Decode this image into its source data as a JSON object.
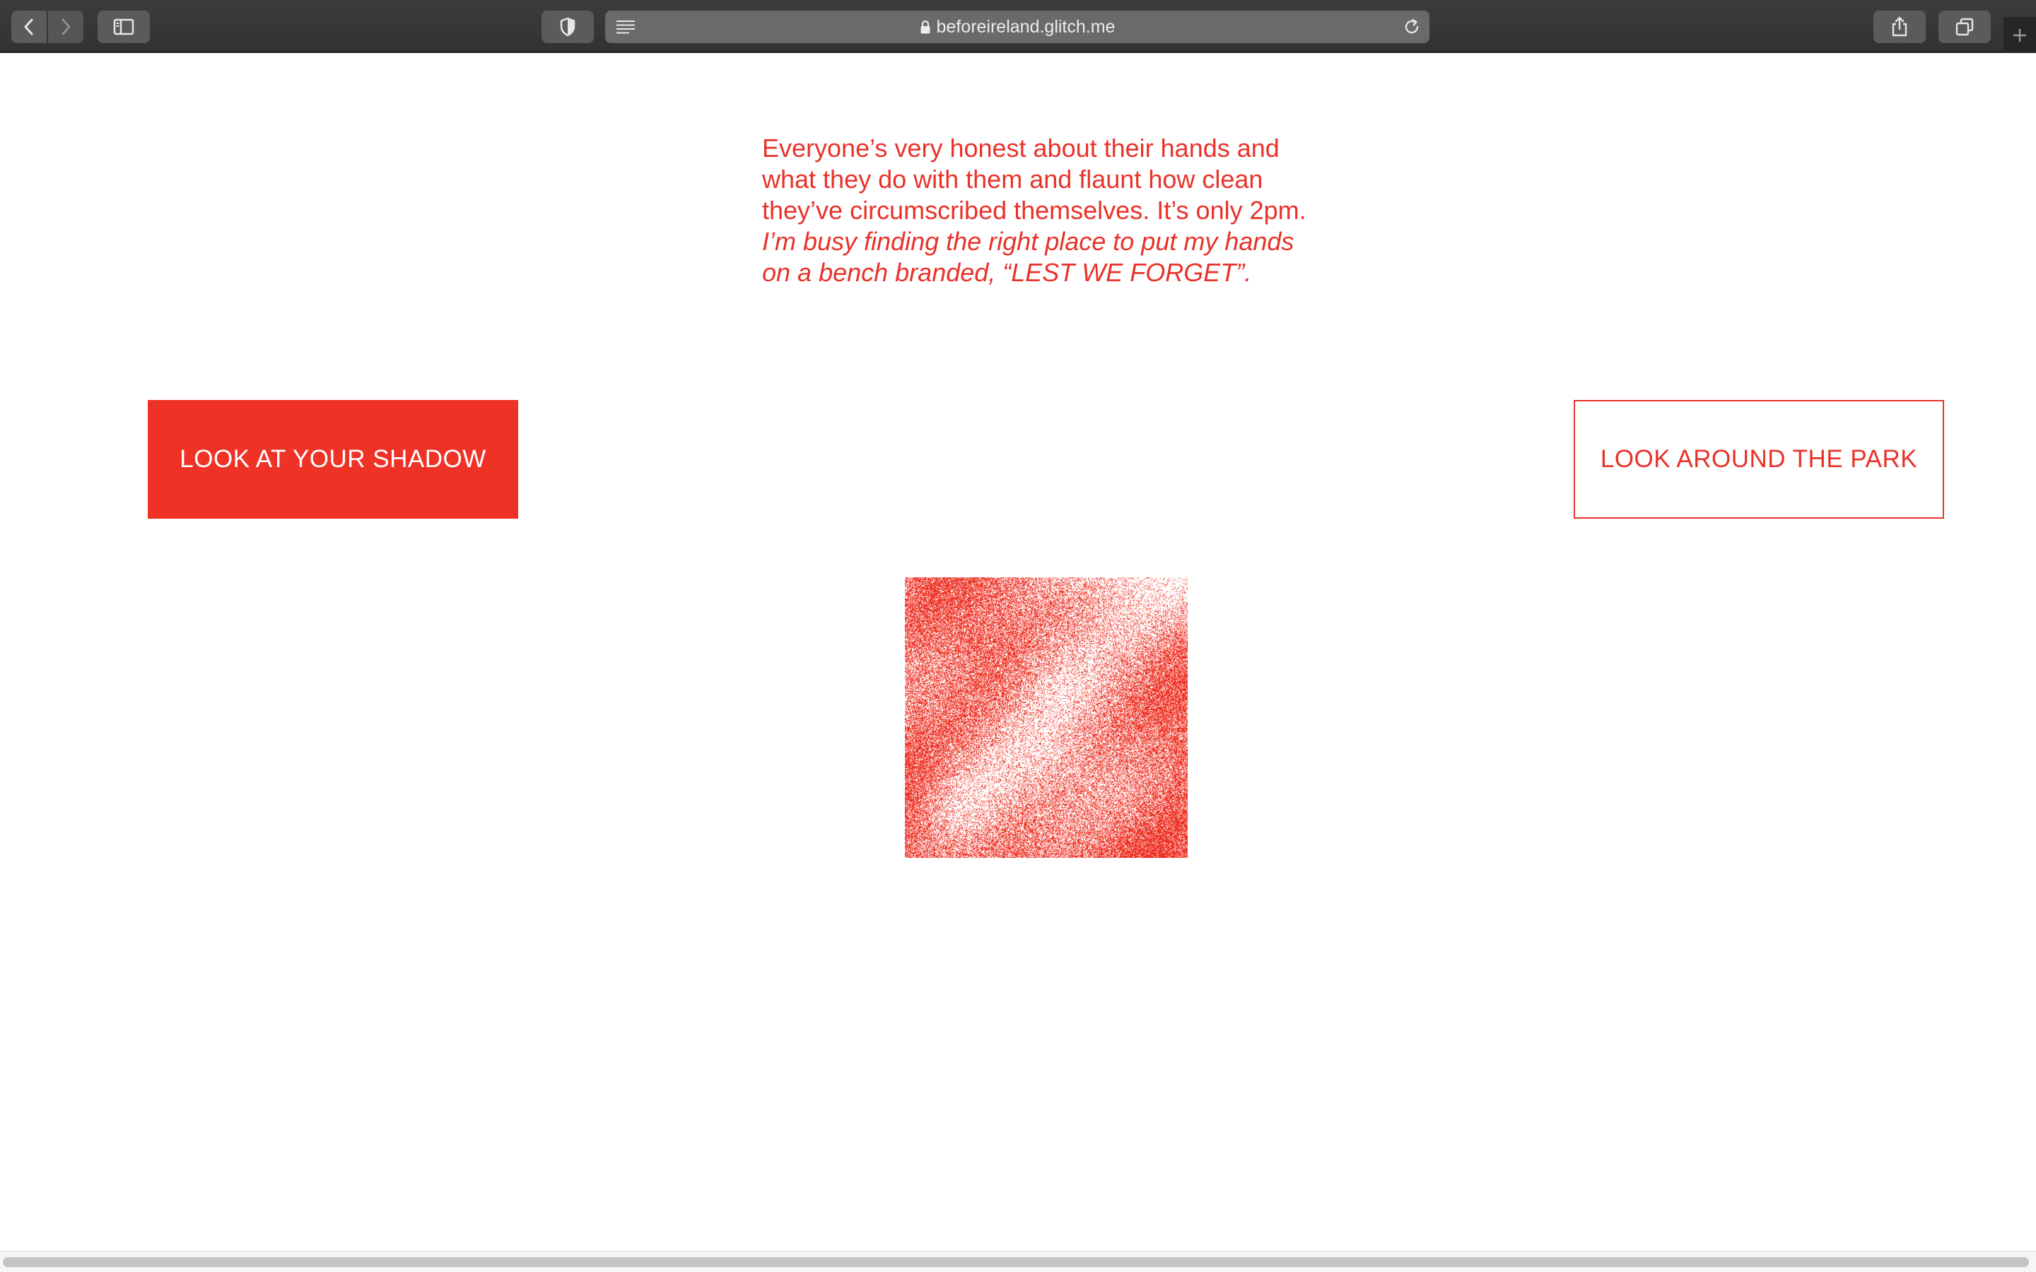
{
  "browser": {
    "url": "beforeireland.glitch.me",
    "icons": {
      "back": "chevron-left-icon",
      "forward": "chevron-right-icon",
      "sidebar": "sidebar-icon",
      "privacy": "shield-icon",
      "reader": "reader-mode-icon",
      "lock": "lock-icon",
      "reload": "reload-icon",
      "share": "share-icon",
      "tabs": "tabs-overview-icon",
      "new_tab": "plus-icon"
    }
  },
  "poem": {
    "lines": [
      "Everyone’s very honest about their hands and",
      "what they do with them and flaunt how clean",
      "they’ve circumscribed themselves. It’s only 2pm."
    ],
    "italic_lines": [
      "I’m busy finding the right place to put my hands",
      "on a bench branded, “LEST WE FORGET”."
    ]
  },
  "choices": {
    "left": "LOOK AT YOUR SHADOW",
    "right": "LOOK AROUND THE PARK"
  },
  "colors": {
    "accent": "#ee3326",
    "text": "#e8322a",
    "background": "#ffffff",
    "chrome": "#3a3a3a"
  }
}
